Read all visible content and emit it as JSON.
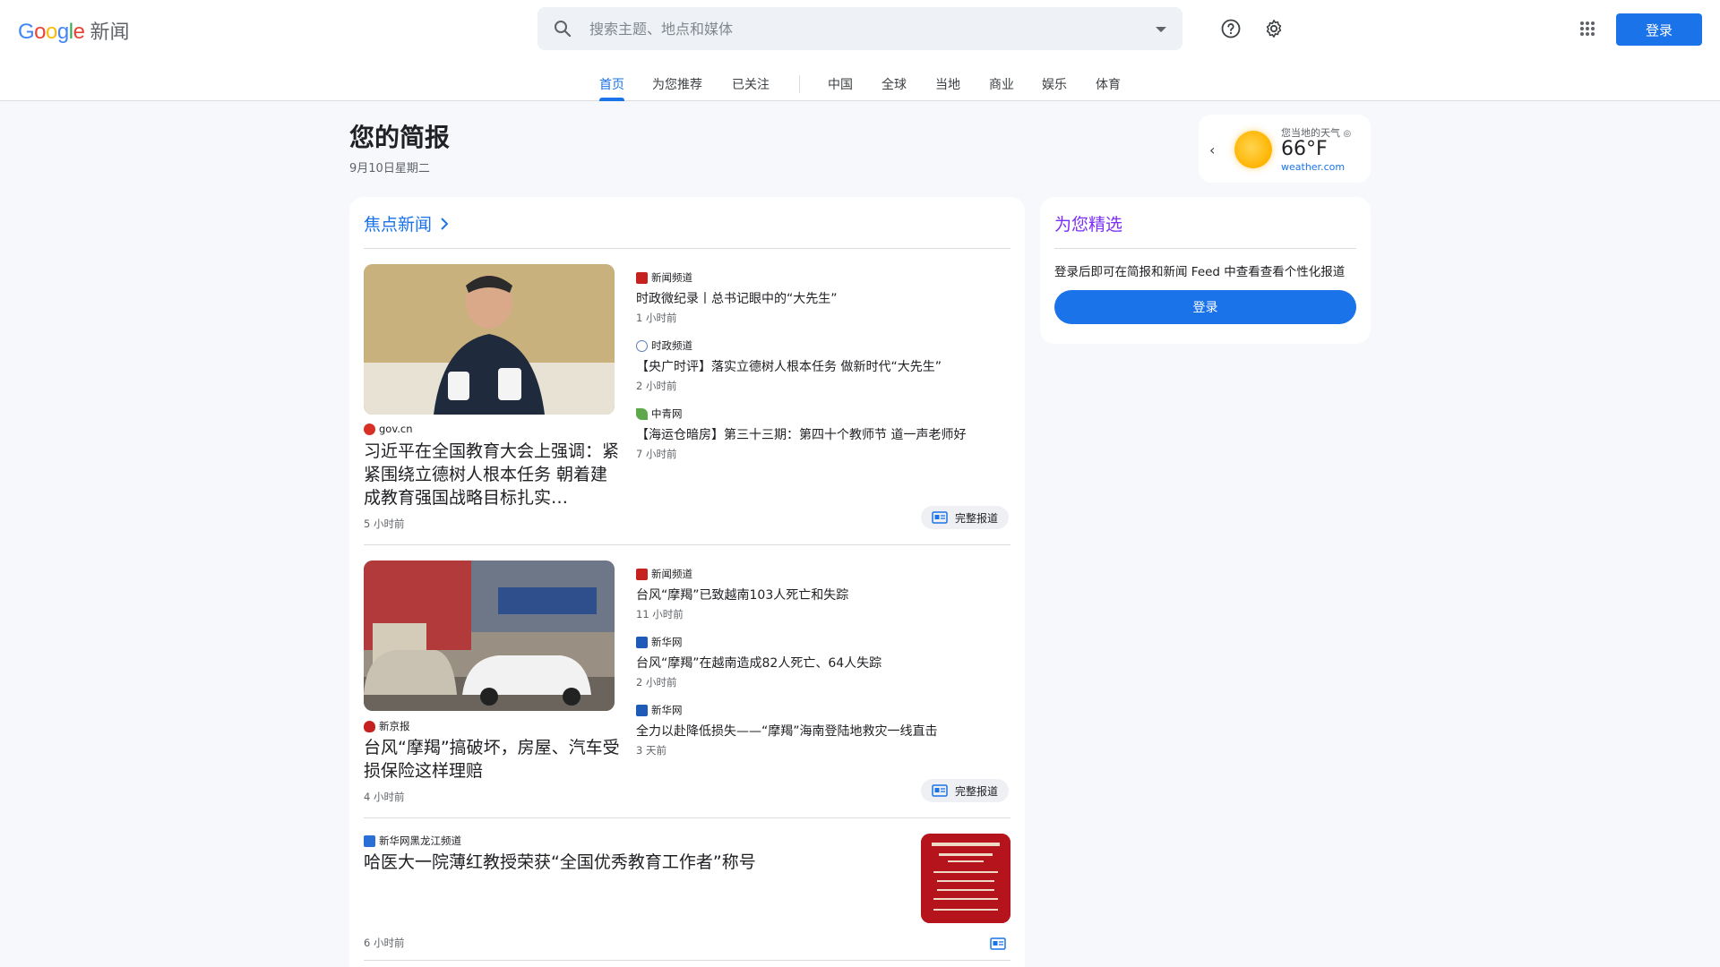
{
  "header": {
    "logo_text": "Google",
    "logo_suffix": "新闻",
    "search_placeholder": "搜索主题、地点和媒体",
    "login_label": "登录"
  },
  "nav": {
    "tabs": [
      {
        "label": "首页",
        "active": true
      },
      {
        "label": "为您推荐"
      },
      {
        "label": "已关注"
      },
      {
        "label": "中国"
      },
      {
        "label": "全球"
      },
      {
        "label": "当地"
      },
      {
        "label": "商业"
      },
      {
        "label": "娱乐"
      },
      {
        "label": "体育"
      }
    ]
  },
  "briefing": {
    "title": "您的简报",
    "date": "9月10日星期二"
  },
  "weather": {
    "label": "您当地的天气",
    "temp": "66°F",
    "source": "weather.com"
  },
  "top_stories": {
    "title": "焦点新闻",
    "full_coverage_label": "完整报道",
    "stories": [
      {
        "main": {
          "source": "gov.cn",
          "headline": "习近平在全国教育大会上强调：紧紧围绕立德树人根本任务 朝着建成教育强国战略目标扎实…",
          "time": "5 小时前"
        },
        "related": [
          {
            "source": "新闻频道",
            "headline": "时政微纪录丨总书记眼中的“大先生”",
            "time": "1 小时前"
          },
          {
            "source": "时政频道",
            "headline": "【央广时评】落实立德树人根本任务 做新时代“大先生”",
            "time": "2 小时前"
          },
          {
            "source": "中青网",
            "headline": "【海运仓暗房】第三十三期：第四十个教师节 道一声老师好",
            "time": "7 小时前"
          }
        ]
      },
      {
        "main": {
          "source": "新京报",
          "headline": "台风“摩羯”搞破坏，房屋、汽车受损保险这样理赔",
          "time": "4 小时前"
        },
        "related": [
          {
            "source": "新闻频道",
            "headline": "台风“摩羯”已致越南103人死亡和失踪",
            "time": "11 小时前"
          },
          {
            "source": "新华网",
            "headline": "台风“摩羯”在越南造成82人死亡、64人失踪",
            "time": "2 小时前"
          },
          {
            "source": "新华网",
            "headline": "全力以赴降低损失——“摩羯”海南登陆地救灾一线直击",
            "time": "3 天前"
          }
        ]
      },
      {
        "main": {
          "source": "新华网黑龙江频道",
          "headline": "哈医大一院薄红教授荣获“全国优秀教育工作者”称号",
          "time": "6 小时前"
        }
      }
    ]
  },
  "picks": {
    "title": "为您精选",
    "desc": "登录后即可在简报和新闻 Feed 中查看查看个性化报道",
    "login_label": "登录"
  },
  "colors": {
    "accent": "#1a73e8",
    "picks_title": "#7b2ff7"
  }
}
